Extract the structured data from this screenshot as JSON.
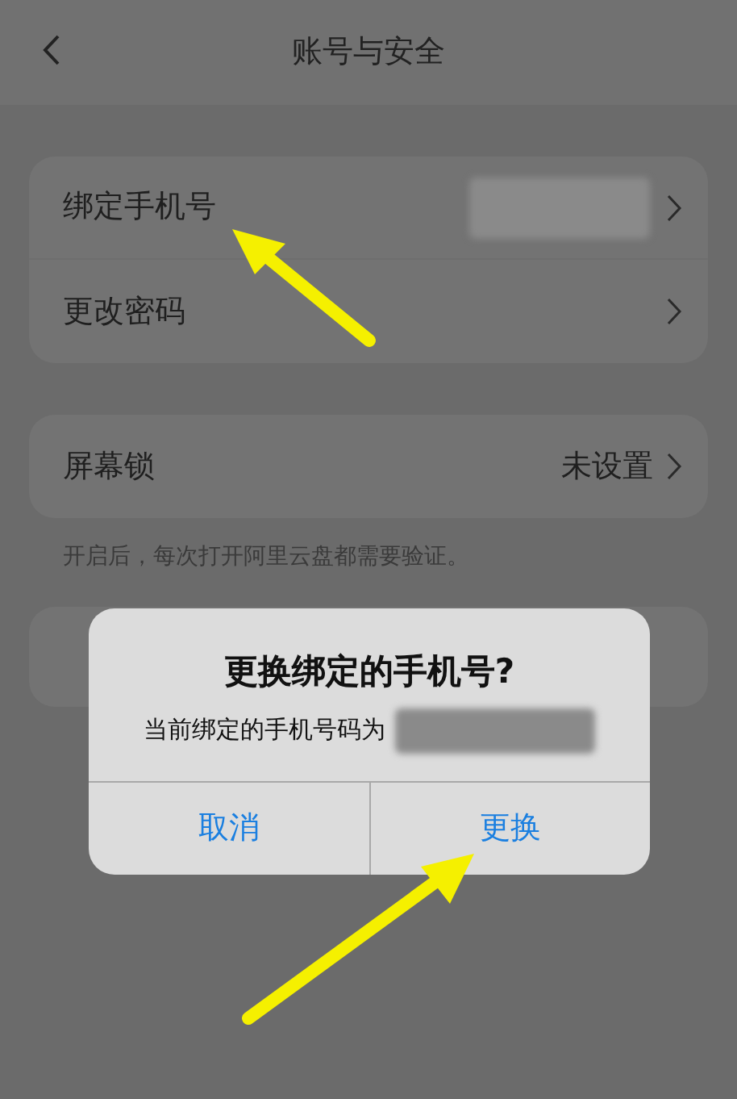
{
  "header": {
    "title": "账号与安全"
  },
  "groups": [
    {
      "rows": [
        {
          "label": "绑定手机号",
          "kind": "masked"
        },
        {
          "label": "更改密码",
          "kind": "plain"
        }
      ]
    },
    {
      "rows": [
        {
          "label": "屏幕锁",
          "kind": "value",
          "value": "未设置"
        }
      ],
      "note": "开启后，每次打开阿里云盘都需要验证。"
    },
    {
      "rows": [
        {
          "kind": "hidden"
        }
      ]
    }
  ],
  "dialog": {
    "title": "更换绑定的手机号?",
    "message": "当前绑定的手机号码为",
    "buttons": [
      {
        "label": "取消"
      },
      {
        "label": "更换"
      }
    ]
  }
}
